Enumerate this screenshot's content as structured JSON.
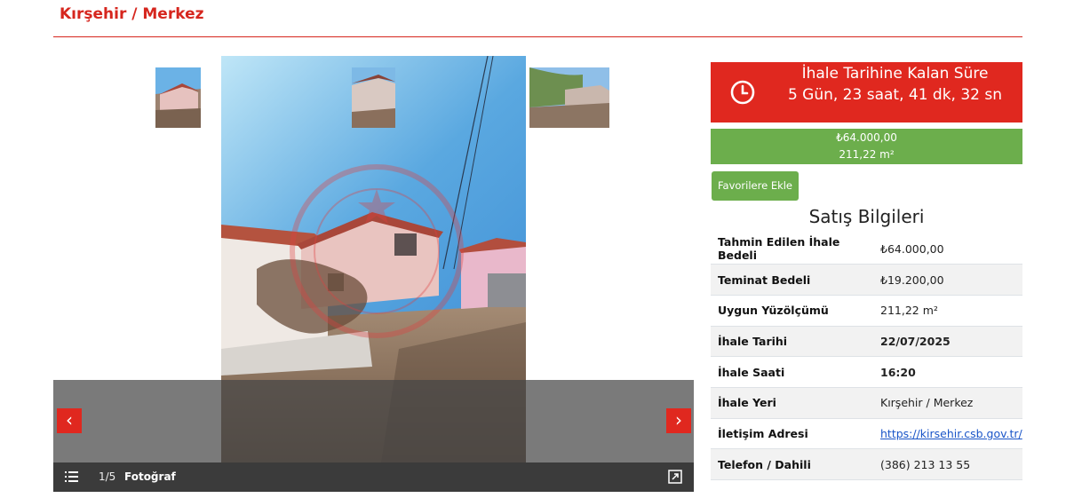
{
  "header": {
    "title": "Kırşehir / Merkez"
  },
  "gallery": {
    "counter": "1/5",
    "label": "Fotoğraf",
    "prev_label": "‹",
    "next_label": "›",
    "main_image": "house-photo",
    "thumbnails": [
      "house-thumb",
      "house-side-thumb",
      "garden-thumb"
    ]
  },
  "countdown": {
    "title": "İhale Tarihine Kalan Süre",
    "value": "5 Gün, 23 saat, 41 dk, 32 sn",
    "icon": "clock-icon"
  },
  "price_box": {
    "price": "₺64.000,00",
    "area": "211,22 m²"
  },
  "favorite_button": "Favorilere Ekle",
  "sale_info": {
    "title": "Satış Bilgileri",
    "rows": [
      {
        "label": "Tahmin Edilen İhale Bedeli",
        "value": "₺64.000,00"
      },
      {
        "label": "Teminat Bedeli",
        "value": "₺19.200,00"
      },
      {
        "label": "Uygun Yüzölçümü",
        "value": "211,22 m²"
      },
      {
        "label": "İhale Tarihi",
        "value": "22/07/2025"
      },
      {
        "label": "İhale Saati",
        "value": "16:20"
      },
      {
        "label": "İhale Yeri",
        "value": "Kırşehir / Merkez"
      },
      {
        "label": "İletişim Adresi",
        "value": "https://kirsehir.csb.gov.tr/"
      },
      {
        "label": "Telefon / Dahili",
        "value": "(386) 213 13 55"
      }
    ]
  },
  "colors": {
    "accent_red": "#e0281f",
    "accent_green": "#6cae4c",
    "title_red": "#d6261e"
  }
}
